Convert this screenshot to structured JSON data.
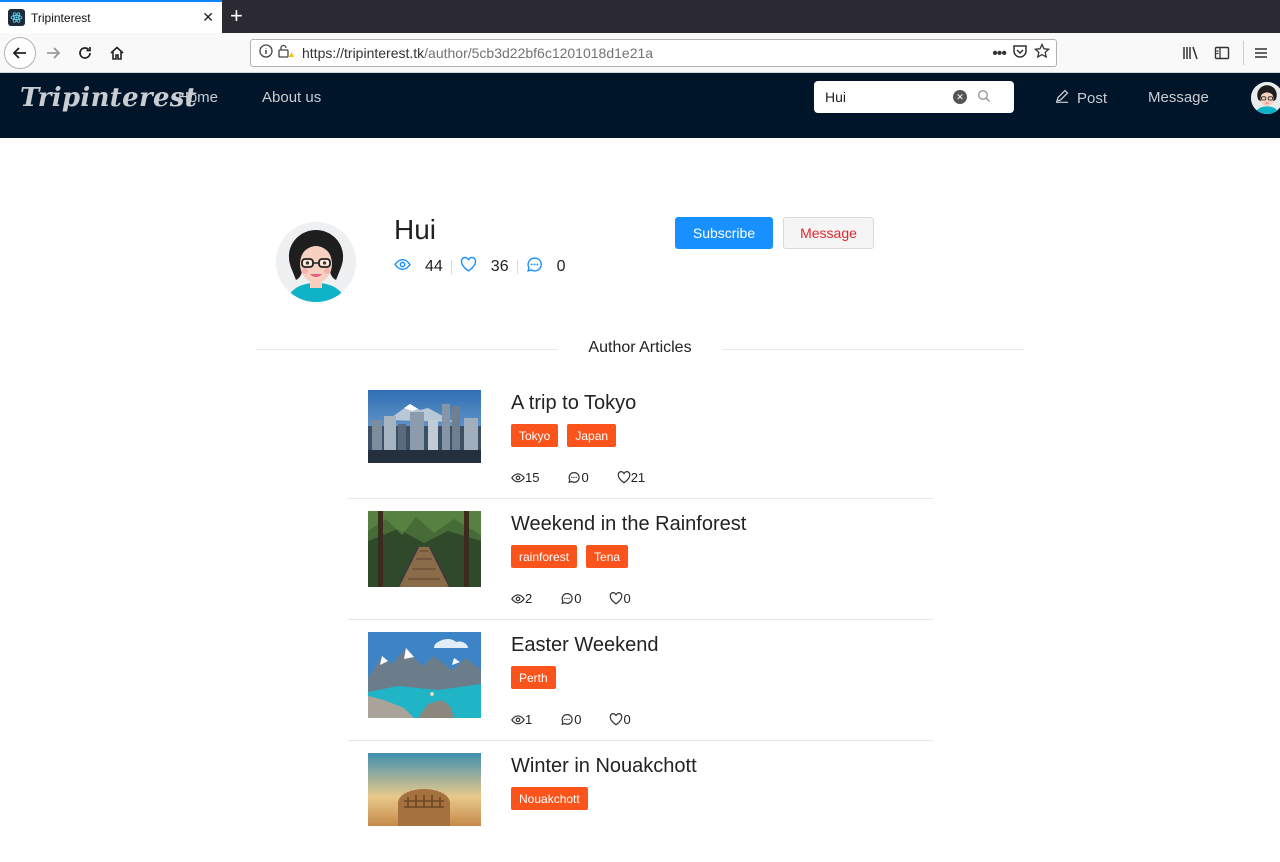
{
  "browser": {
    "tab_title": "Tripinterest",
    "url_host": "https://tripinterest.tk",
    "url_path": "/author/5cb3d22bf6c1201018d1e21a"
  },
  "header": {
    "logo": "Tripinterest",
    "nav": [
      "Home",
      "About us"
    ],
    "search_value": "Hui",
    "post_label": "Post",
    "message_label": "Message"
  },
  "profile": {
    "name": "Hui",
    "views": "44",
    "likes": "36",
    "comments": "0",
    "subscribe_label": "Subscribe",
    "message_label": "Message"
  },
  "section_title": "Author Articles",
  "articles": [
    {
      "title": "A trip to Tokyo",
      "tags": [
        "Tokyo",
        "Japan"
      ],
      "views": "15",
      "comments": "0",
      "likes": "21"
    },
    {
      "title": "Weekend in the Rainforest",
      "tags": [
        "rainforest",
        "Tena"
      ],
      "views": "2",
      "comments": "0",
      "likes": "0"
    },
    {
      "title": "Easter Weekend",
      "tags": [
        "Perth"
      ],
      "views": "1",
      "comments": "0",
      "likes": "0"
    },
    {
      "title": "Winter in Nouakchott",
      "tags": [
        "Nouakchott"
      ],
      "views": "",
      "comments": "",
      "likes": ""
    }
  ],
  "colors": {
    "header_bg": "#001529",
    "primary": "#1890ff",
    "tag": "#fa541c",
    "danger": "#e0282e"
  }
}
